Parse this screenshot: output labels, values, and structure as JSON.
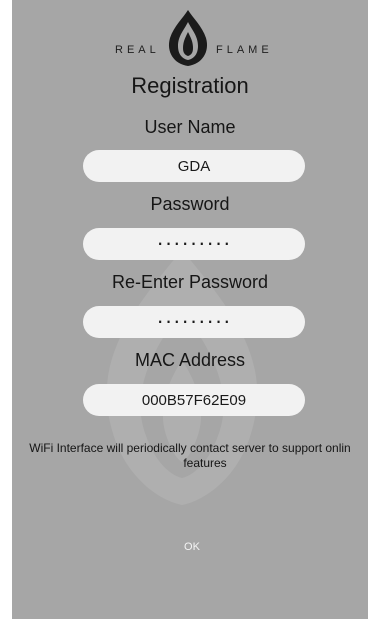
{
  "brand": {
    "left_word": "REAL",
    "right_word": "FLAME"
  },
  "title": "Registration",
  "fields": {
    "username": {
      "label": "User Name",
      "value": "GDA"
    },
    "password": {
      "label": "Password",
      "value": "·········"
    },
    "reenter_password": {
      "label": "Re-Enter Password",
      "value": "·········"
    },
    "mac_address": {
      "label": "MAC Address",
      "value": "000B57F62E09"
    }
  },
  "notice": {
    "line1": "WiFi Interface will periodically contact server to support onlin",
    "line2": "features"
  },
  "ok_label": "OK",
  "colors": {
    "background": "#a6a6a6",
    "field": "#f2f2f2",
    "text": "#161616"
  },
  "icons": {
    "logo": "real-flame-logo-icon",
    "watermark": "flame-watermark-icon"
  }
}
